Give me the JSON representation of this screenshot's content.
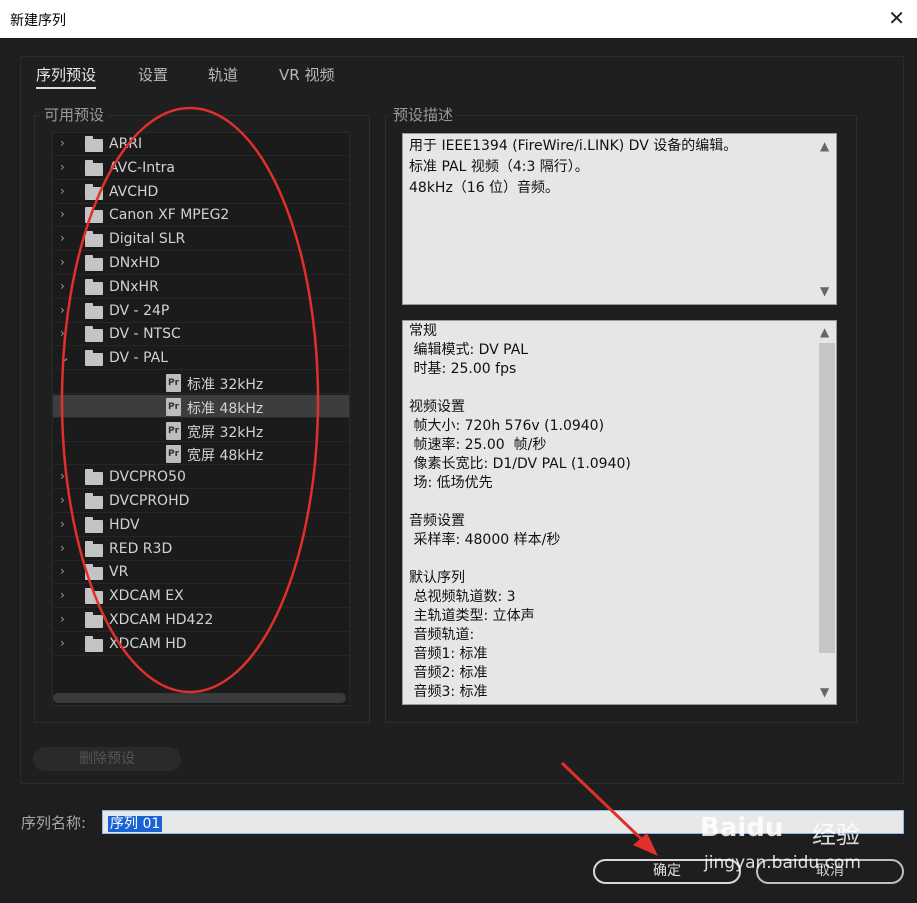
{
  "window": {
    "title": "新建序列",
    "close_glyph": "✕"
  },
  "tabs": [
    {
      "label": "序列预设",
      "active": true
    },
    {
      "label": "设置",
      "active": false
    },
    {
      "label": "轨道",
      "active": false
    },
    {
      "label": "VR 视频",
      "active": false
    }
  ],
  "presets": {
    "group_label": "可用预设",
    "items": [
      {
        "label": "ARRI",
        "type": "folder",
        "expanded": false
      },
      {
        "label": "AVC-Intra",
        "type": "folder",
        "expanded": false
      },
      {
        "label": "AVCHD",
        "type": "folder",
        "expanded": false
      },
      {
        "label": "Canon XF MPEG2",
        "type": "folder",
        "expanded": false
      },
      {
        "label": "Digital SLR",
        "type": "folder",
        "expanded": false
      },
      {
        "label": "DNxHD",
        "type": "folder",
        "expanded": false
      },
      {
        "label": "DNxHR",
        "type": "folder",
        "expanded": false
      },
      {
        "label": "DV - 24P",
        "type": "folder",
        "expanded": false
      },
      {
        "label": "DV - NTSC",
        "type": "folder",
        "expanded": false
      },
      {
        "label": "DV - PAL",
        "type": "folder",
        "expanded": true
      },
      {
        "label": "标准 32kHz",
        "type": "preset",
        "selected": false
      },
      {
        "label": "标准 48kHz",
        "type": "preset",
        "selected": true
      },
      {
        "label": "宽屏 32kHz",
        "type": "preset",
        "selected": false
      },
      {
        "label": "宽屏 48kHz",
        "type": "preset",
        "selected": false
      },
      {
        "label": "DVCPRO50",
        "type": "folder",
        "expanded": false
      },
      {
        "label": "DVCPROHD",
        "type": "folder",
        "expanded": false
      },
      {
        "label": "HDV",
        "type": "folder",
        "expanded": false
      },
      {
        "label": "RED R3D",
        "type": "folder",
        "expanded": false
      },
      {
        "label": "VR",
        "type": "folder",
        "expanded": false
      },
      {
        "label": "XDCAM EX",
        "type": "folder",
        "expanded": false
      },
      {
        "label": "XDCAM HD422",
        "type": "folder",
        "expanded": false
      },
      {
        "label": "XDCAM HD",
        "type": "folder",
        "expanded": false
      }
    ],
    "preset_icon_text": "Pr"
  },
  "description": {
    "group_label": "预设描述",
    "lines": [
      "用于 IEEE1394 (FireWire/i.LINK) DV 设备的编辑。",
      "标准 PAL 视频（4:3 隔行）。",
      "48kHz（16 位）音频。"
    ]
  },
  "details": {
    "lines": [
      "常规",
      " 编辑模式: DV PAL",
      " 时基: 25.00 fps",
      "",
      "视频设置",
      " 帧大小: 720h 576v (1.0940)",
      " 帧速率: 25.00  帧/秒",
      " 像素长宽比: D1/DV PAL (1.0940)",
      " 场: 低场优先",
      "",
      "音频设置",
      " 采样率: 48000 样本/秒",
      "",
      "默认序列",
      " 总视频轨道数: 3",
      " 主轨道类型: 立体声",
      " 音频轨道:",
      " 音频1: 标准",
      " 音频2: 标准",
      " 音频3: 标准"
    ]
  },
  "delete_button": "删除预设",
  "sequence_name": {
    "label": "序列名称:",
    "value": "序列 01"
  },
  "buttons": {
    "ok": "确定",
    "cancel": "取消"
  },
  "watermark": {
    "brand": "Baidu",
    "cn": "经验",
    "url": "jingyan.baidu.com"
  },
  "scroll_arrows": {
    "up": "▲",
    "down": "▼"
  },
  "tree_arrows": {
    "collapsed": "›",
    "expanded": "⌄"
  },
  "annotation_color": "#e0302c"
}
